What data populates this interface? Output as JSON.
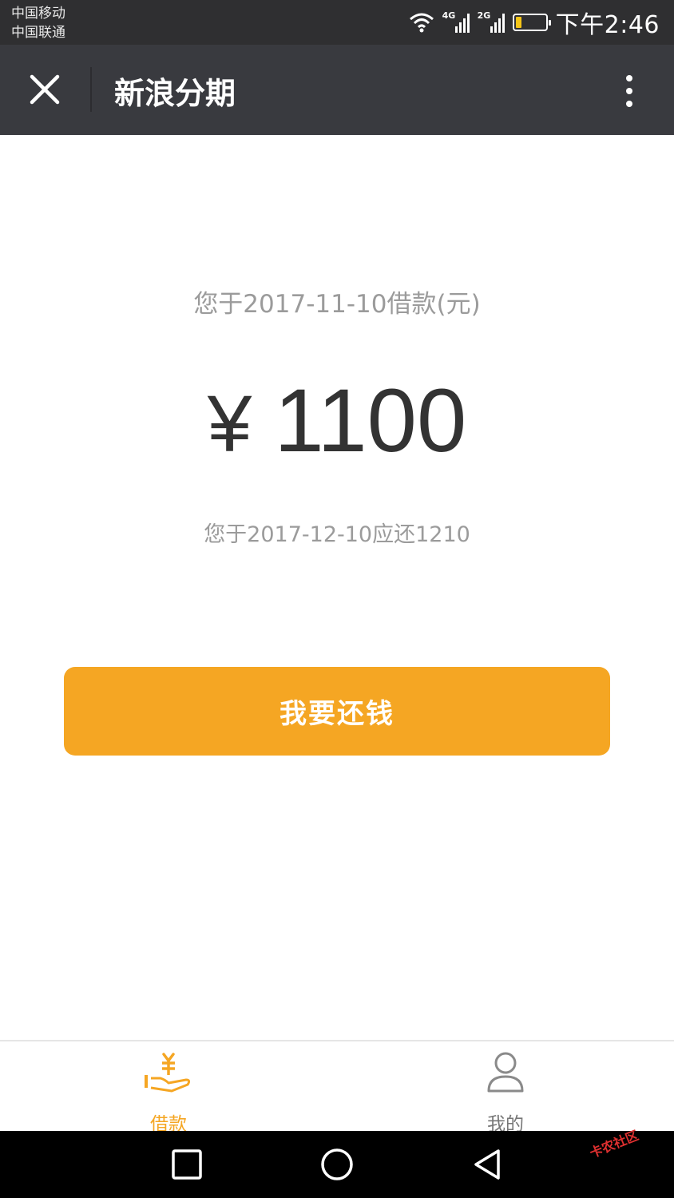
{
  "status_bar": {
    "carrier_1": "中国移动",
    "carrier_2": "中国联通",
    "sig1_tag": "4G",
    "sig2_tag": "2G",
    "time": "下午2:46",
    "battery_color": "#f5c518"
  },
  "title_bar": {
    "title": "新浪分期",
    "close_icon": "close-icon",
    "more_icon": "more-vertical-icon"
  },
  "main": {
    "loan_date_text": "您于2017-11-10借款(元)",
    "currency": "¥",
    "amount": "1100",
    "repay_note": "您于2017-12-10应还1210",
    "repay_button": "我要还钱",
    "accent_color": "#f5a623"
  },
  "tabs": [
    {
      "label": "借款",
      "icon": "loan-hand-icon",
      "active": true
    },
    {
      "label": "我的",
      "icon": "user-icon",
      "active": false
    }
  ],
  "nav_bar": {
    "recent_icon": "square-icon",
    "home_icon": "circle-icon",
    "back_icon": "triangle-back-icon"
  },
  "watermark": {
    "text": "卡农社区"
  }
}
